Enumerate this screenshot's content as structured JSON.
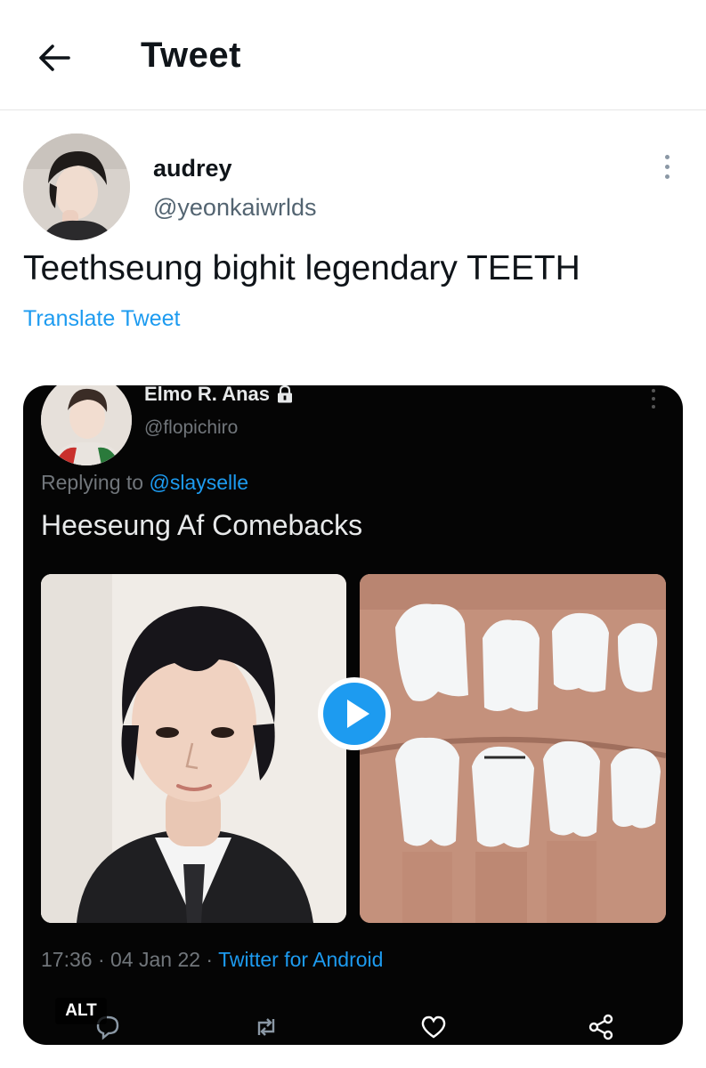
{
  "header": {
    "title": "Tweet",
    "back_icon": "arrow-left-icon"
  },
  "author": {
    "display_name": "audrey",
    "handle": "@yeonkaiwrlds"
  },
  "tweet": {
    "text": "Teethseung bighit legendary TEETH",
    "translate_label": "Translate Tweet"
  },
  "media": {
    "alt_label": "ALT",
    "embedded_tweet": {
      "display_name": "Elmo R. Anas",
      "handle": "@flopichiro",
      "replying_prefix": "Replying to ",
      "replying_to": "@slayselle",
      "text": "Heeseung Af Comebacks",
      "time": "17:36",
      "date": "04 Jan 22",
      "source": "Twitter for Android",
      "separator": " · "
    }
  },
  "colors": {
    "accent": "#1d9bf0",
    "dark_bg": "#050505",
    "muted": "#536471"
  }
}
